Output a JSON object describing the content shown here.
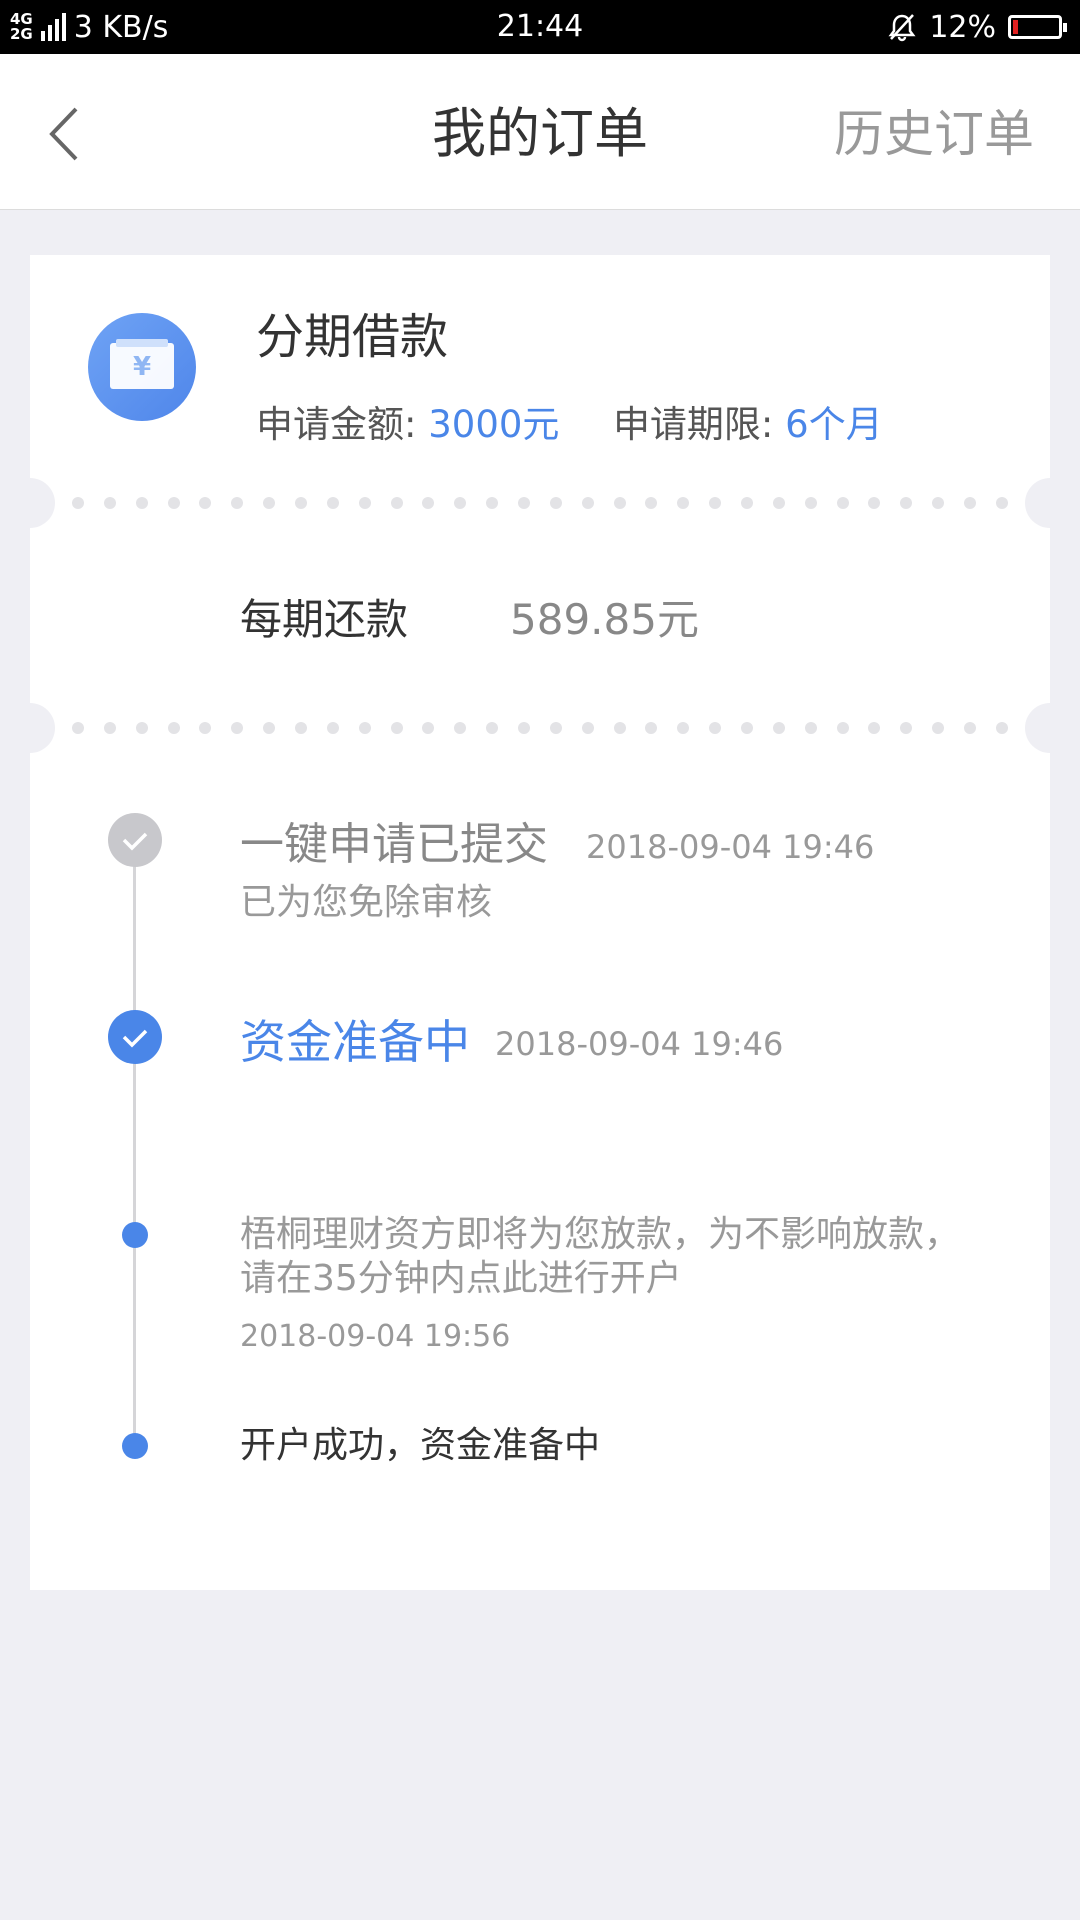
{
  "status_bar": {
    "network_top": "4G",
    "network_bottom": "2G",
    "speed": "3 KB/s",
    "time": "21:44",
    "battery": "12%",
    "battery_level": 0.12
  },
  "nav": {
    "back_icon": "chevron-left-icon",
    "title": "我的订单",
    "history": "历史订单"
  },
  "order": {
    "icon": "wallet-yen-icon",
    "yen_symbol": "¥",
    "title": "分期借款",
    "amount_label": "申请金额: ",
    "amount_value": "3000元",
    "term_label": "申请期限: ",
    "term_value": "6个月",
    "repay_label": "每期还款",
    "repay_value": "589.85元"
  },
  "timeline": {
    "step1": {
      "title": "一键申请已提交",
      "time": "2018-09-04 19:46",
      "note": "已为您免除审核"
    },
    "step2": {
      "title": "资金准备中",
      "time": "2018-09-04 19:46"
    },
    "step3": {
      "text": "梧桐理财资方即将为您放款，为不影响放款，请在35分钟内点此进行开户",
      "time": "2018-09-04 19:56"
    },
    "step4": {
      "text": "开户成功，资金准备中"
    }
  },
  "colors": {
    "accent": "#4a86e8",
    "background": "#efeff4"
  }
}
